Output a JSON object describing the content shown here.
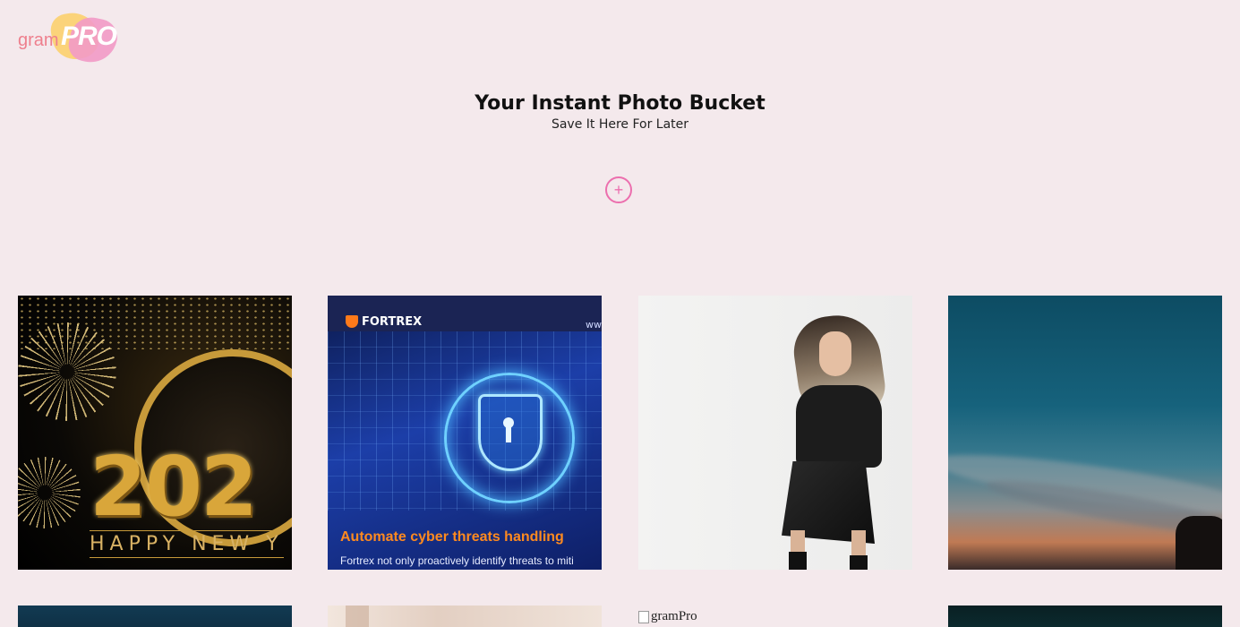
{
  "logo": {
    "gram": "gram",
    "pro": "PRO"
  },
  "header": {
    "title": "Your Instant Photo Bucket",
    "subtitle": "Save It Here For Later"
  },
  "add_button": {
    "symbol": "+"
  },
  "gallery": {
    "tiles": [
      {
        "subject": "new-year-2022",
        "year_text": "202",
        "caption": "HAPPY NEW Y"
      },
      {
        "subject": "fortrex-cyber",
        "brand": "FORTREX",
        "url_text": "ww",
        "headline": "Automate cyber threats handling",
        "desc": "Fortrex not only proactively identify threats to miti"
      },
      {
        "subject": "fashion-model"
      },
      {
        "subject": "sky-sunset"
      },
      {
        "subject": "night-sky"
      },
      {
        "subject": "beige-fabric"
      },
      {
        "subject": "broken-image",
        "alt": "gramPro"
      },
      {
        "subject": "dark-teal"
      }
    ]
  },
  "colors": {
    "background": "#f4e9ec",
    "accent_pink": "#ec6fae",
    "logo_yellow": "#fbd37a",
    "logo_pink": "#f29ac7",
    "logo_text": "#ee7f8d"
  }
}
